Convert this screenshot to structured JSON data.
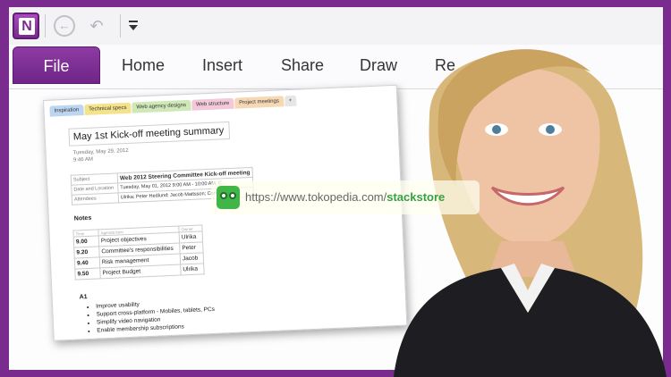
{
  "qat": {
    "app_icon_letter": "N",
    "back_icon": "back-arrow-icon",
    "undo_icon": "undo-icon",
    "customize_icon": "customize-dropdown-icon"
  },
  "tabs": {
    "file": "File",
    "home": "Home",
    "insert": "Insert",
    "share": "Share",
    "draw": "Draw",
    "review_partial": "Re"
  },
  "colors": {
    "brand_purple": "#7a2b8e",
    "file_tab": "#7d3296"
  },
  "note": {
    "sections": [
      "Inspiration",
      "Technical specs",
      "Web agency designs",
      "Web structure",
      "Project meetings",
      "+"
    ],
    "title": "May 1st Kick-off meeting summary",
    "date": "Tuesday, May 29, 2012",
    "time": "9:46 AM",
    "info_rows": [
      {
        "label": "Subject",
        "value": "Web 2012  Steering Committee Kick-off meeting"
      },
      {
        "label": "Date and Location",
        "value": "Tuesday, May 01, 2012 9:00 AM - 10:00 AM, C..."
      },
      {
        "label": "Attendees",
        "value": "Ulrika; Peter Hedlund; Jacob Mattsson; Conle..."
      }
    ],
    "notes_heading": "Notes",
    "agenda_header": [
      "Time",
      "Agenda item",
      "Owner"
    ],
    "agenda": [
      {
        "time": "9.00",
        "item": "Project objectives",
        "owner": "Ulrika"
      },
      {
        "time": "9.20",
        "item": "Committee's responsibilities",
        "owner": "Peter"
      },
      {
        "time": "9.40",
        "item": "Risk management",
        "owner": "Jacob"
      },
      {
        "time": "9.50",
        "item": "Project Budget",
        "owner": "Ulrika"
      }
    ],
    "a1_heading": "A1",
    "bullets": [
      "Improve usability",
      "Support cross-platform - Mobiles, tablets, PCs",
      "Simplify video navigation",
      "Enable membership subscriptions"
    ]
  },
  "watermark": {
    "url_prefix": "https://www.tokopedia.com/",
    "url_highlight": "stackstore"
  }
}
